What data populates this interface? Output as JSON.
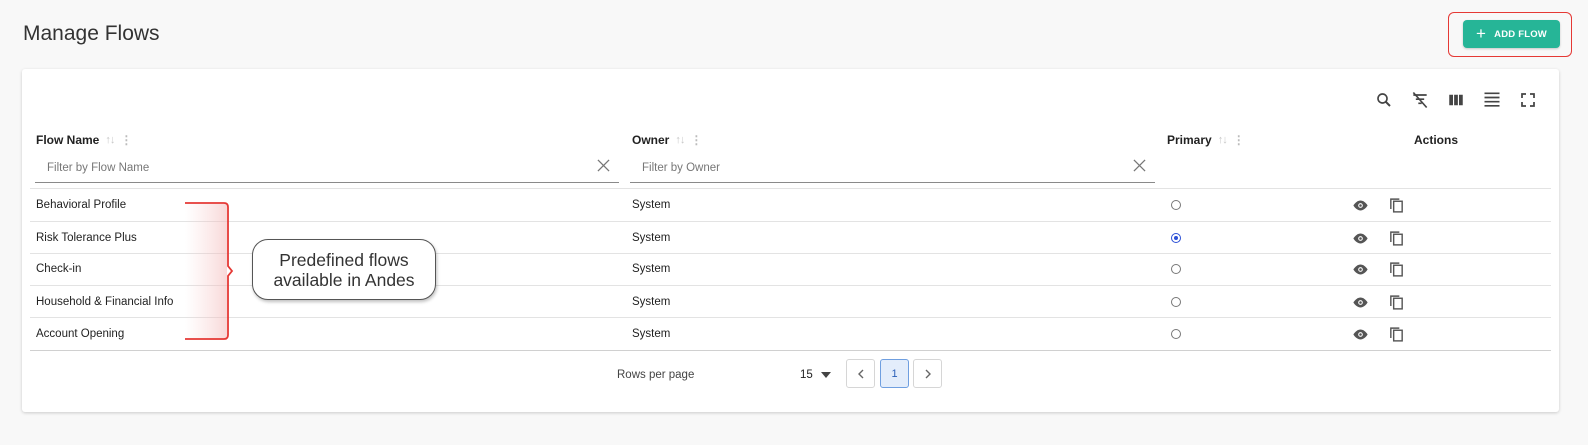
{
  "page": {
    "title": "Manage Flows"
  },
  "header": {
    "add_button_label": "ADD FLOW"
  },
  "toolbar": {
    "icons": [
      "search-icon",
      "filter-off-icon",
      "columns-icon",
      "density-icon",
      "fullscreen-icon"
    ]
  },
  "table": {
    "columns": {
      "flow_name": "Flow Name",
      "owner": "Owner",
      "primary": "Primary",
      "actions": "Actions"
    },
    "filters": {
      "flow_name_placeholder": "Filter by Flow Name",
      "owner_placeholder": "Filter by Owner"
    },
    "rows": [
      {
        "name": "Behavioral Profile",
        "owner": "System",
        "primary": false
      },
      {
        "name": "Risk Tolerance Plus",
        "owner": "System",
        "primary": true
      },
      {
        "name": "Check-in",
        "owner": "System",
        "primary": false
      },
      {
        "name": "Household & Financial Info",
        "owner": "System",
        "primary": false
      },
      {
        "name": "Account Opening",
        "owner": "System",
        "primary": false
      }
    ]
  },
  "pagination": {
    "rows_per_page_label": "Rows per page",
    "rows_per_page_value": "15",
    "current_page": "1"
  },
  "annotation": {
    "line1": "Predefined flows",
    "line2": "available in Andes"
  },
  "colors": {
    "accent": "#26b597",
    "highlight": "#e53935",
    "radio_selected": "#2b4fd6"
  }
}
